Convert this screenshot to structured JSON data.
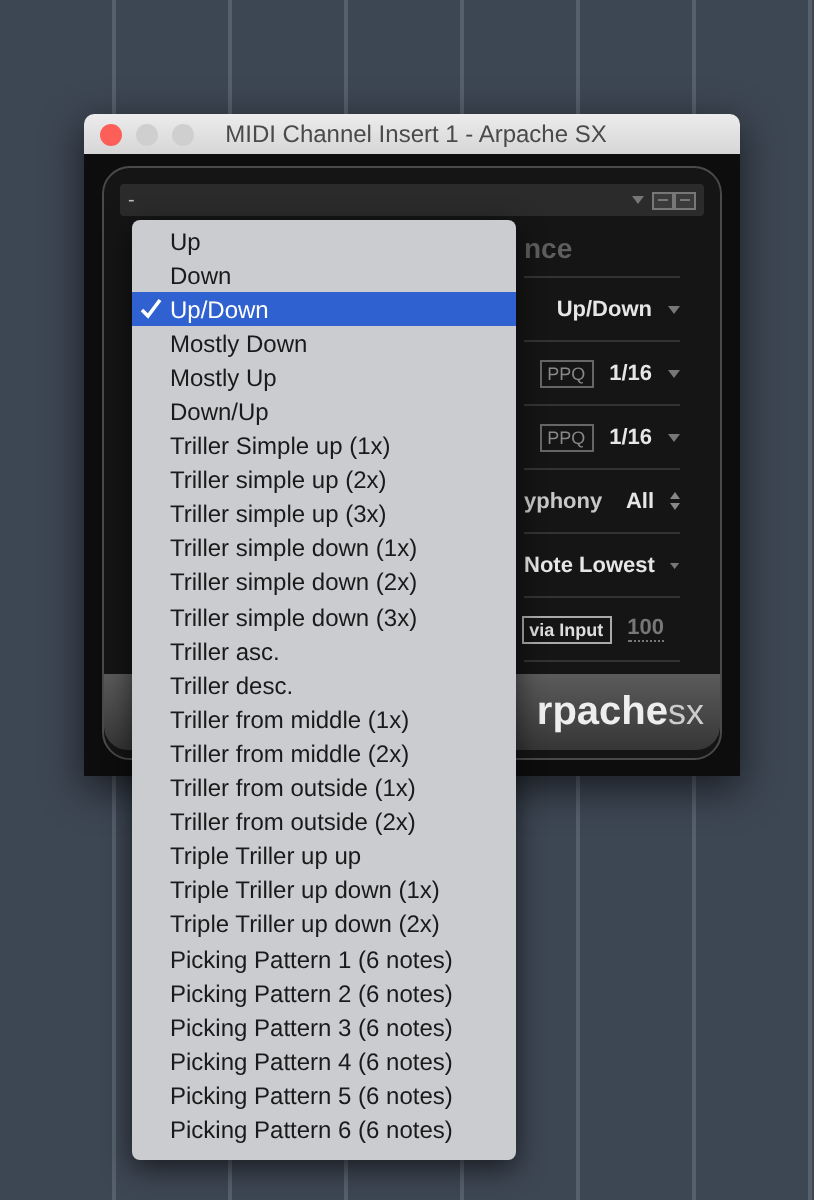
{
  "window": {
    "title": "MIDI Channel Insert 1 - Arpache SX"
  },
  "preset": {
    "value": "-"
  },
  "section_heading": "nce",
  "rows": [
    {
      "kind": "dropdown",
      "value": "Up/Down"
    },
    {
      "kind": "ppq",
      "badge": "PPQ",
      "value": "1/16"
    },
    {
      "kind": "ppq",
      "badge": "PPQ",
      "value": "1/16"
    },
    {
      "kind": "spinner",
      "label": "yphony",
      "value": "All"
    },
    {
      "kind": "dropdown",
      "value": "Note Lowest"
    },
    {
      "kind": "input",
      "badge": "via Input",
      "value": "100"
    }
  ],
  "logo": {
    "bold": "rpache",
    "light": "sx"
  },
  "menu": {
    "items": [
      {
        "label": "Up",
        "selected": false
      },
      {
        "label": "Down",
        "selected": false
      },
      {
        "label": "Up/Down",
        "selected": true
      },
      {
        "label": "Mostly Down",
        "selected": false
      },
      {
        "label": "Mostly Up",
        "selected": false
      },
      {
        "label": "Down/Up",
        "selected": false
      },
      {
        "label": "Triller Simple up (1x)",
        "selected": false
      },
      {
        "label": "Triller simple up (2x)",
        "selected": false
      },
      {
        "label": "Triller simple up (3x)",
        "selected": false
      },
      {
        "label": "Triller simple down (1x)",
        "selected": false
      },
      {
        "label": "Triller simple down (2x)",
        "selected": false
      },
      {
        "label": "Triller simple down (3x)",
        "selected": false
      },
      {
        "label": "Triller asc.",
        "selected": false
      },
      {
        "label": "Triller desc.",
        "selected": false
      },
      {
        "label": "Triller from middle (1x)",
        "selected": false
      },
      {
        "label": "Triller from middle (2x)",
        "selected": false
      },
      {
        "label": "Triller from outside (1x)",
        "selected": false
      },
      {
        "label": "Triller from outside (2x)",
        "selected": false
      },
      {
        "label": "Triple Triller up up",
        "selected": false
      },
      {
        "label": "Triple Triller up down (1x)",
        "selected": false
      },
      {
        "label": "Triple Triller up down (2x)",
        "selected": false
      },
      {
        "label": "Picking Pattern 1 (6 notes)",
        "selected": false
      },
      {
        "label": "Picking Pattern 2 (6 notes)",
        "selected": false
      },
      {
        "label": "Picking Pattern 3 (6 notes)",
        "selected": false
      },
      {
        "label": "Picking Pattern 4 (6 notes)",
        "selected": false
      },
      {
        "label": "Picking Pattern 5 (6 notes)",
        "selected": false
      },
      {
        "label": "Picking Pattern 6 (6 notes)",
        "selected": false
      }
    ]
  }
}
